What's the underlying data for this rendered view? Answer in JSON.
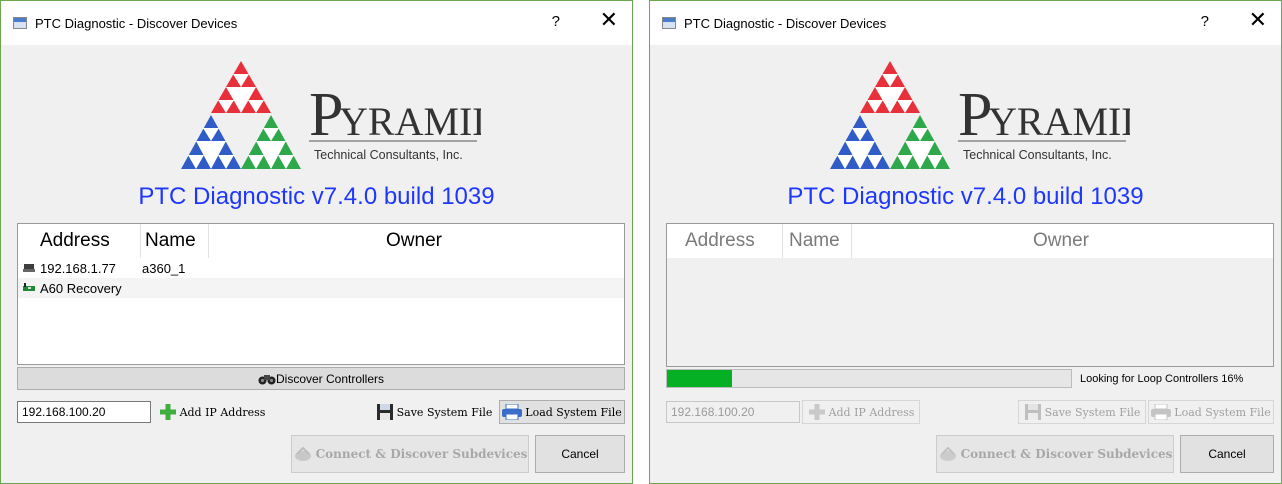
{
  "windows": [
    {
      "title": "PTC Diagnostic - Discover Devices",
      "help_label": "?",
      "close_label": "✕",
      "logo": {
        "brand": "YRAMID",
        "brand_initial": "P",
        "tagline": "Technical Consultants, Inc."
      },
      "heading": "PTC Diagnostic v7.4.0 build 1039",
      "columns": [
        "Address",
        "Name",
        "Owner"
      ],
      "rows": [
        {
          "icon": "network-device-icon",
          "address": "192.168.1.77",
          "name": "a360_1",
          "owner": ""
        },
        {
          "icon": "circuit-board-icon",
          "address": "A60 Recovery",
          "name": "",
          "owner": ""
        }
      ],
      "discover_label": "Discover Controllers",
      "ip_value": "192.168.100.20",
      "add_ip_label": "Add IP Address",
      "save_label": "Save System File",
      "load_label": "Load System File",
      "connect_label": "Connect & Discover Subdevices",
      "cancel_label": "Cancel"
    },
    {
      "title": "PTC Diagnostic - Discover Devices",
      "help_label": "?",
      "close_label": "✕",
      "logo": {
        "brand": "YRAMID",
        "brand_initial": "P",
        "tagline": "Technical Consultants, Inc."
      },
      "heading": "PTC Diagnostic v7.4.0 build 1039",
      "columns": [
        "Address",
        "Name",
        "Owner"
      ],
      "rows": [],
      "progress": {
        "percent": 16,
        "text": "Looking for Loop Controllers 16%"
      },
      "ip_value": "192.168.100.20",
      "add_ip_label": "Add IP Address",
      "save_label": "Save System File",
      "load_label": "Load System File",
      "connect_label": "Connect & Discover Subdevices",
      "cancel_label": "Cancel"
    }
  ],
  "colors": {
    "heading": "#1e37ff",
    "progress": "#06b025",
    "logo_red": "#e8303a",
    "logo_blue": "#2f5cc6",
    "logo_green": "#2ea84a",
    "border": "#6aa84f"
  }
}
